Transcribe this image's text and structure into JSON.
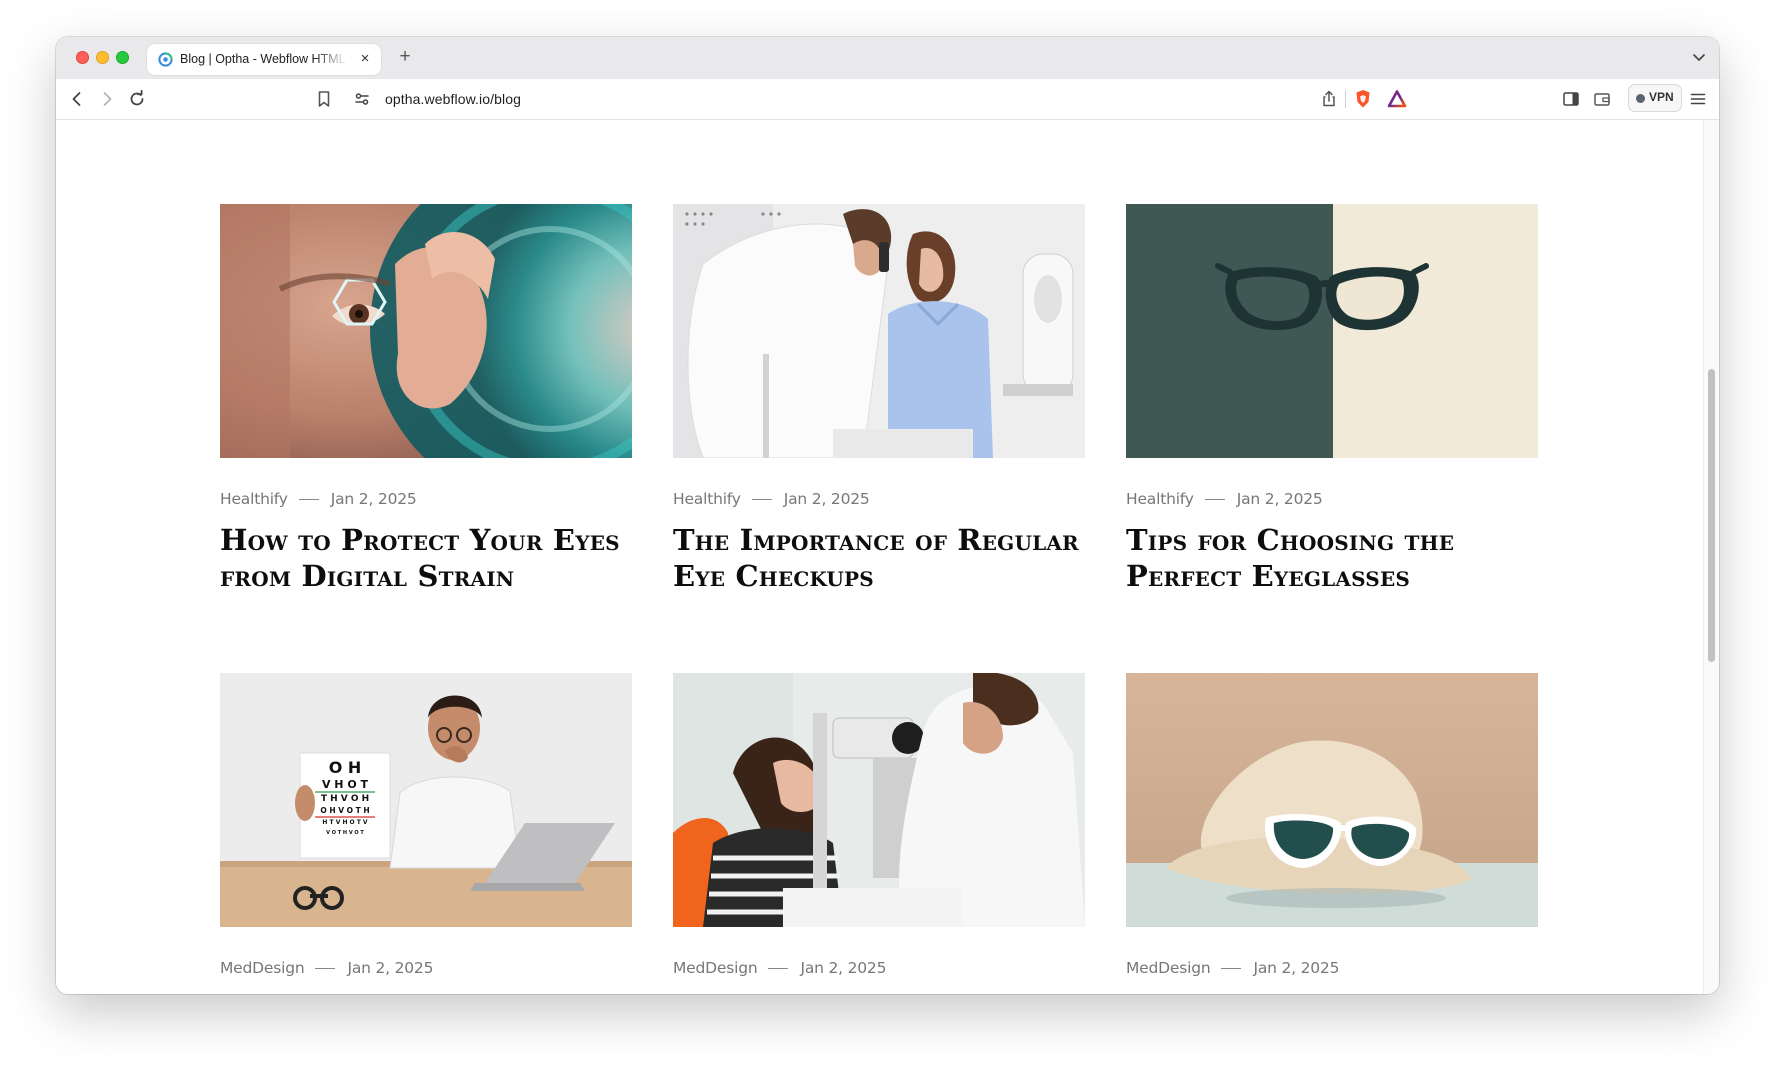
{
  "browser": {
    "tab_title": "Blog | Optha - Webflow HTML website template",
    "url": "optha.webflow.io/blog",
    "vpn_label": "VPN",
    "new_tab_glyph": "+",
    "close_glyph": "×"
  },
  "posts": [
    {
      "category": "Healthify",
      "date": "Jan 2, 2025",
      "title": "How to Protect Your Eyes from Digital Strain",
      "image": "eye-hexagon-scan-photo"
    },
    {
      "category": "Healthify",
      "date": "Jan 2, 2025",
      "title": "The Importance of Regular Eye Checkups",
      "image": "doctor-ophthalmoscope-exam-photo"
    },
    {
      "category": "Healthify",
      "date": "Jan 2, 2025",
      "title": "Tips for Choosing the Perfect Eyeglasses",
      "image": "cat-eye-glasses-two-tone-photo"
    },
    {
      "category": "MedDesign",
      "date": "Jan 2, 2025",
      "title": "",
      "image": "man-eye-chart-laptop-photo"
    },
    {
      "category": "MedDesign",
      "date": "Jan 2, 2025",
      "title": "",
      "image": "slit-lamp-exam-photo"
    },
    {
      "category": "MedDesign",
      "date": "Jan 2, 2025",
      "title": "",
      "image": "hat-sunglasses-photo"
    }
  ],
  "colors": {
    "meta_text": "#777777",
    "title_text": "#0d0d0d",
    "accent_teal": "#2fb5b5"
  }
}
